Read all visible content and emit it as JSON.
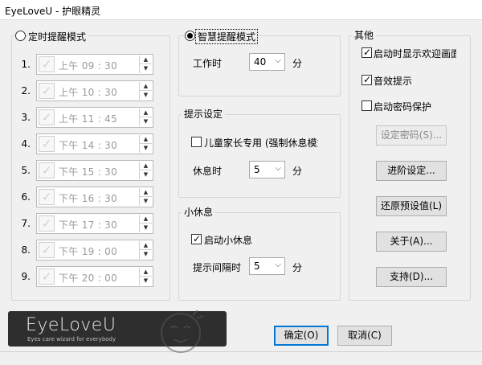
{
  "window": {
    "title": "EyeLoveU - 护眼精灵"
  },
  "timer_mode": {
    "label": "定时提醒模式",
    "rows": [
      {
        "index": "1.",
        "time": "上午 09 : 30"
      },
      {
        "index": "2.",
        "time": "上午 10 : 30"
      },
      {
        "index": "3.",
        "time": "上午 11 : 45"
      },
      {
        "index": "4.",
        "time": "下午 14 : 30"
      },
      {
        "index": "5.",
        "time": "下午 15 : 30"
      },
      {
        "index": "6.",
        "time": "下午 16 : 30"
      },
      {
        "index": "7.",
        "time": "下午 17 : 30"
      },
      {
        "index": "8.",
        "time": "下午 19 : 00"
      },
      {
        "index": "9.",
        "time": "下午 20 : 00"
      }
    ]
  },
  "smart_mode": {
    "label": "智慧提醒模式",
    "work_label": "工作时",
    "work_value": "40",
    "work_unit": "分"
  },
  "hint_settings": {
    "label": "提示设定",
    "parent_mode_label": "儿童家长专用 (强制休息模式",
    "rest_label": "休息时",
    "rest_value": "5",
    "rest_unit": "分"
  },
  "mini_break": {
    "label": "小休息",
    "enable_label": "启动小休息",
    "interval_label": "提示间隔时",
    "interval_value": "5",
    "interval_unit": "分"
  },
  "other": {
    "label": "其他",
    "show_welcome_label": "启动时显示欢迎画面",
    "sound_label": "音效提示",
    "password_label": "启动密码保护",
    "set_password_button": "设定密码(S)...",
    "advanced_button": "进阶设定...",
    "restore_button": "还原预设值(L)",
    "about_button": "关于(A)...",
    "support_button": "支持(D)..."
  },
  "logo": {
    "name": "EyeLoveU",
    "tagline": "Eyes care wizard for everybody"
  },
  "footer": {
    "ok_button": "确定(O)",
    "cancel_button": "取消(C)"
  }
}
